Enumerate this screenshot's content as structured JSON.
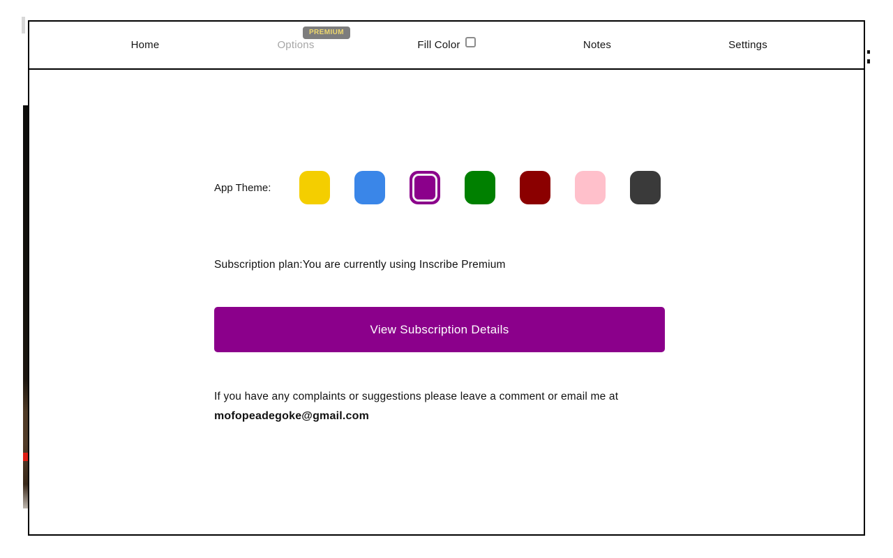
{
  "nav": {
    "items": [
      {
        "label": "Home"
      },
      {
        "label": "Options",
        "badge": "PREMIUM"
      },
      {
        "label": "Fill Color",
        "checkbox_checked": false
      },
      {
        "label": "Notes"
      },
      {
        "label": "Settings"
      }
    ],
    "badge_colors": {
      "bg": "#7d7d7d",
      "text": "#eed86e"
    }
  },
  "theme": {
    "label": "App Theme:",
    "swatches": [
      {
        "name": "yellow",
        "color": "#f4ce00",
        "selected": false
      },
      {
        "name": "blue",
        "color": "#3a86e8",
        "selected": false
      },
      {
        "name": "purple",
        "color": "#8b008b",
        "selected": true
      },
      {
        "name": "green",
        "color": "#008000",
        "selected": false
      },
      {
        "name": "dark-red",
        "color": "#8b0000",
        "selected": false
      },
      {
        "name": "pink",
        "color": "#ffc0cb",
        "selected": false
      },
      {
        "name": "dark-gray",
        "color": "#3a3a3a",
        "selected": false
      }
    ],
    "selected_ring_color": "#f3f3f3"
  },
  "subscription": {
    "status_text": "Subscription plan:You are currently using Inscribe Premium",
    "button_label": "View Subscription Details",
    "button_color": "#8b008b"
  },
  "feedback": {
    "line1": "If you have any complaints or suggestions please leave a comment or email me at",
    "email": "mofopeadegoke@gmail.com"
  }
}
